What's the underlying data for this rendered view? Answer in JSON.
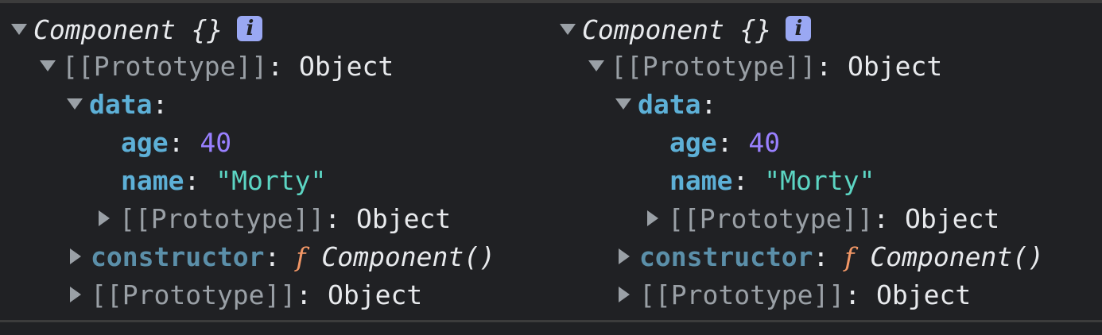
{
  "panels": [
    {
      "object_name": "Component {}",
      "info_label": "i",
      "proto_label": "[[Prototype]]",
      "proto_value": "Object",
      "data_key": "data",
      "age_key": "age",
      "age_value": "40",
      "name_key": "name",
      "name_value": "\"Morty\"",
      "inner_proto_label": "[[Prototype]]",
      "inner_proto_value": "Object",
      "constructor_key": "constructor",
      "constructor_f": "f",
      "constructor_value": "Component()",
      "outer_proto_label": "[[Prototype]]",
      "outer_proto_value": "Object"
    },
    {
      "object_name": "Component {}",
      "info_label": "i",
      "proto_label": "[[Prototype]]",
      "proto_value": "Object",
      "data_key": "data",
      "age_key": "age",
      "age_value": "40",
      "name_key": "name",
      "name_value": "\"Morty\"",
      "inner_proto_label": "[[Prototype]]",
      "inner_proto_value": "Object",
      "constructor_key": "constructor",
      "constructor_f": "f",
      "constructor_value": "Component()",
      "outer_proto_label": "[[Prototype]]",
      "outer_proto_value": "Object"
    }
  ],
  "colors": {
    "background": "#202124",
    "key": "#5db0d7",
    "number": "#9980ff",
    "string": "#5cd5c3",
    "function_f": "#f29766",
    "prototype": "#9aa0a6",
    "info_badge": "#9aa8f3"
  }
}
